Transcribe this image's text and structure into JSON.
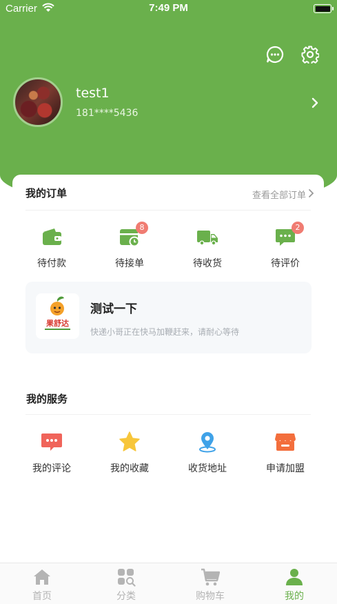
{
  "status_bar": {
    "carrier": "Carrier",
    "time": "7:49 PM"
  },
  "header": {
    "icons": {
      "messages": "message-dots-icon",
      "settings": "gear-icon"
    },
    "accent_color": "#6ab04c"
  },
  "profile": {
    "username": "test1",
    "phone": "181****5436"
  },
  "orders": {
    "title": "我的订单",
    "view_all": "查看全部订单",
    "items": [
      {
        "label": "待付款",
        "icon": "wallet-icon",
        "badge": ""
      },
      {
        "label": "待接单",
        "icon": "calendar-clock-icon",
        "badge": "8"
      },
      {
        "label": "待收货",
        "icon": "truck-icon",
        "badge": ""
      },
      {
        "label": "待评价",
        "icon": "comment-icon",
        "badge": "2"
      }
    ]
  },
  "notice": {
    "logo_text": "果舒达",
    "title": "测试一下",
    "description": "快递小哥正在快马加鞭赶来，请耐心等待"
  },
  "services": {
    "title": "我的服务",
    "items": [
      {
        "label": "我的评论",
        "icon": "review-icon"
      },
      {
        "label": "我的收藏",
        "icon": "star-icon"
      },
      {
        "label": "收货地址",
        "icon": "location-pin-icon"
      },
      {
        "label": "申请加盟",
        "icon": "store-icon"
      }
    ]
  },
  "tabbar": {
    "active": "我的",
    "items": [
      {
        "label": "首页",
        "icon": "home-icon"
      },
      {
        "label": "分类",
        "icon": "category-icon"
      },
      {
        "label": "购物车",
        "icon": "cart-icon"
      },
      {
        "label": "我的",
        "icon": "user-icon"
      }
    ]
  },
  "colors": {
    "green": "#6ab04c",
    "badge": "#f07c72",
    "red_icon": "#f0645a",
    "star": "#f7c63b",
    "blue_pin": "#3fa2e8",
    "orange_store": "#f36e3c"
  }
}
